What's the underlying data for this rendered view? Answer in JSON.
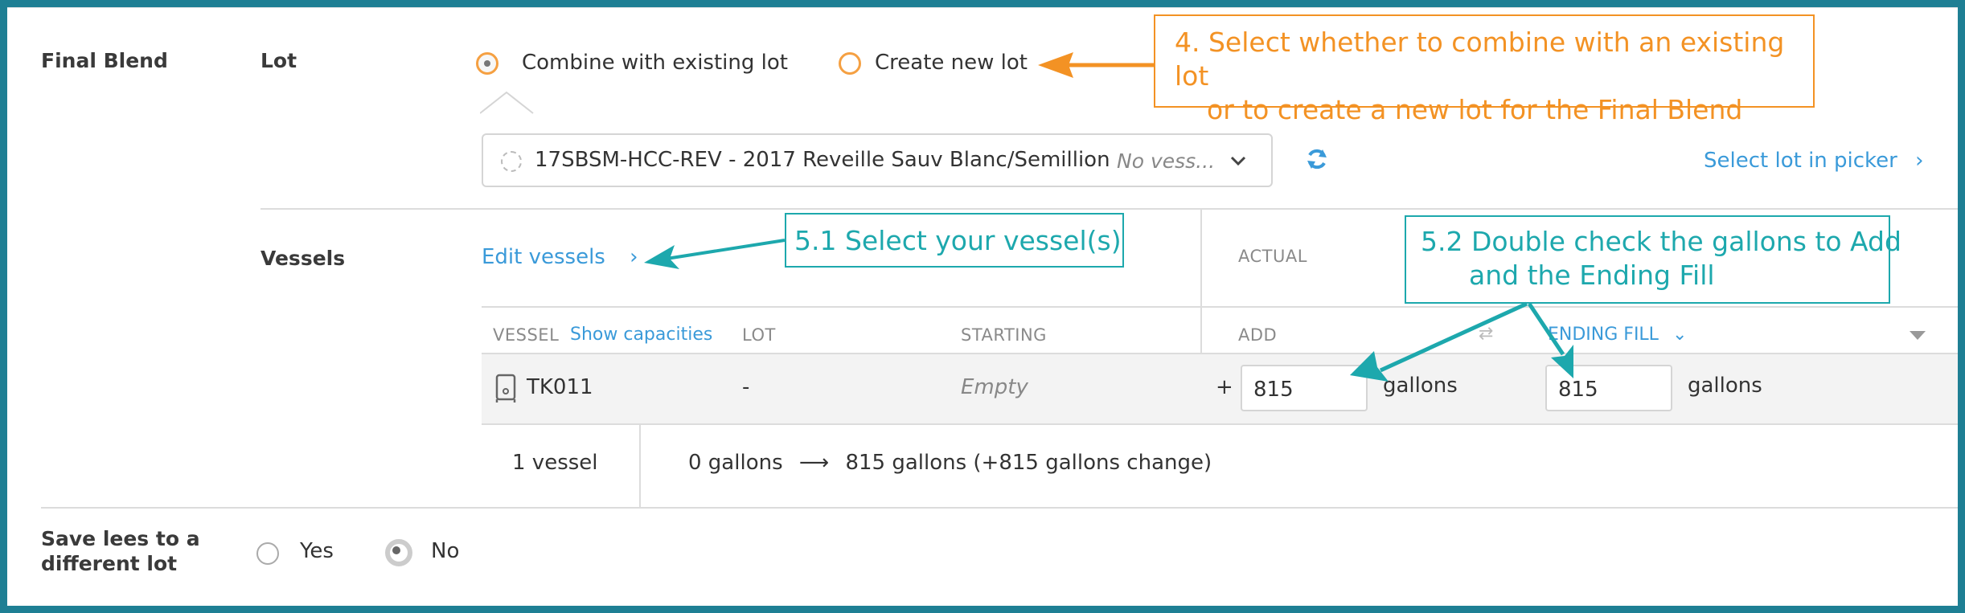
{
  "final_blend": {
    "section_label": "Final Blend",
    "lot_label": "Lot",
    "options": [
      {
        "label": "Combine with existing lot",
        "selected": true
      },
      {
        "label": "Create new lot",
        "selected": false
      }
    ],
    "lot_select": {
      "value": "17SBSM-HCC-REV - 2017 Reveille Sauv Blanc/Semillion",
      "vessel_hint": "No vess..."
    },
    "select_lot_link": "Select lot in picker"
  },
  "vessels": {
    "label": "Vessels",
    "edit_link": "Edit vessels",
    "actual_header": "ACTUAL",
    "columns": {
      "vessel": "VESSEL",
      "show_capacities": "Show capacities",
      "lot": "LOT",
      "starting": "STARTING",
      "add": "ADD",
      "ending_fill": "ENDING FILL"
    },
    "row": {
      "vessel": "TK011",
      "lot": "-",
      "starting": "Empty",
      "plus": "+",
      "add_value": "815",
      "add_unit": "gallons",
      "ending_value": "815",
      "ending_unit": "gallons"
    },
    "summary": {
      "count": "1 vessel",
      "from": "0 gallons",
      "arrow": "⟶",
      "to": "815 gallons (+815 gallons change)"
    }
  },
  "lees": {
    "label_line1": "Save lees to a",
    "label_line2": "different lot",
    "yes": "Yes",
    "no": "No",
    "selected": "No"
  },
  "callouts": {
    "step4_line1": "4. Select whether to combine with an existing lot",
    "step4_line2": "or to create a new lot for the Final Blend",
    "step51": "5.1 Select your vessel(s)",
    "step52_line1": "5.2 Double check the gallons to Add",
    "step52_line2": "and the Ending Fill"
  },
  "colors": {
    "frame": "#1e7f94",
    "orange": "#f39224",
    "teal": "#1da8ad",
    "link_blue": "#3a9ad9"
  }
}
